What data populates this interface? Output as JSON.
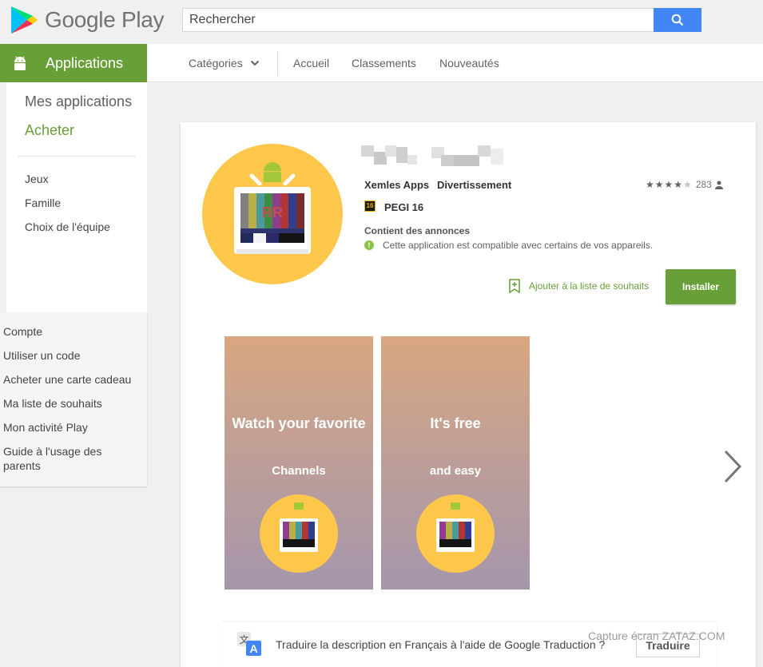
{
  "header": {
    "logo_text": "Google Play",
    "search_placeholder": "Rechercher"
  },
  "nav": {
    "section_label": "Applications",
    "categories_label": "Catégories",
    "items": [
      "Accueil",
      "Classements",
      "Nouveautés"
    ]
  },
  "sidebar": {
    "my_apps": "Mes applications",
    "shop": "Acheter",
    "sub_items": [
      "Jeux",
      "Famille",
      "Choix de l'équipe"
    ],
    "account_links": [
      "Compte",
      "Utiliser un code",
      "Acheter une carte cadeau",
      "Ma liste de souhaits",
      "Mon activité Play",
      "Guide à l'usage des parents"
    ]
  },
  "app": {
    "developer": "Xemles Apps",
    "genre": "Divertissement",
    "rating_stars": 4,
    "rating_count": "283",
    "pegi_badge": "16",
    "pegi_label": "PEGI 16",
    "ads_notice": "Contient des annonces",
    "compat_text": "Cette application est compatible avec certains de vos appareils.",
    "wishlist_label": "Ajouter à la liste de souhaits",
    "install_label": "Installer"
  },
  "screenshots": [
    {
      "line1": "Watch your favorite",
      "line2": "Channels"
    },
    {
      "line1": "It's free",
      "line2": "and easy"
    }
  ],
  "translate": {
    "text": "Traduire la description en Français à l'aide de Google Traduction ?",
    "button": "Traduire"
  },
  "watermark": "Capture écran ZATAZ.COM",
  "colors": {
    "brand_green": "#689f38",
    "search_blue": "#4285f4",
    "icon_yellow": "#fdc74c"
  }
}
